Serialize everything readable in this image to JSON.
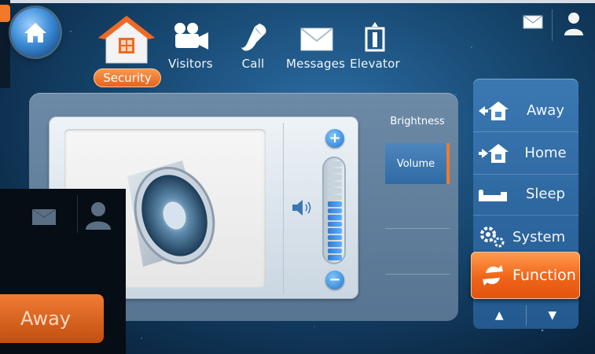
{
  "nav": {
    "items": [
      {
        "label": "Security",
        "icon": "house-icon",
        "active": true
      },
      {
        "label": "Visitors",
        "icon": "camera-icon"
      },
      {
        "label": "Call",
        "icon": "phone-icon"
      },
      {
        "label": "Messages",
        "icon": "envelope-icon"
      },
      {
        "label": "Elevator",
        "icon": "elevator-icon"
      }
    ]
  },
  "settings_tabs": [
    {
      "label": "Brightness",
      "active": false
    },
    {
      "label": "Volume",
      "active": true
    }
  ],
  "volume": {
    "level": 0.6,
    "segments": 15
  },
  "sidebar": {
    "items": [
      {
        "label": "Away",
        "icon": "away-house-icon"
      },
      {
        "label": "Home",
        "icon": "home-arrive-icon"
      },
      {
        "label": "Sleep",
        "icon": "sleep-icon"
      },
      {
        "label": "System",
        "icon": "gears-icon"
      }
    ],
    "function": {
      "label": "Function",
      "icon": "refresh-icon"
    }
  },
  "overlay": {
    "away_label": "Away"
  },
  "colors": {
    "accent": "#f07a2a",
    "panel": "#577592",
    "sidebar": "#2f6aa4"
  }
}
